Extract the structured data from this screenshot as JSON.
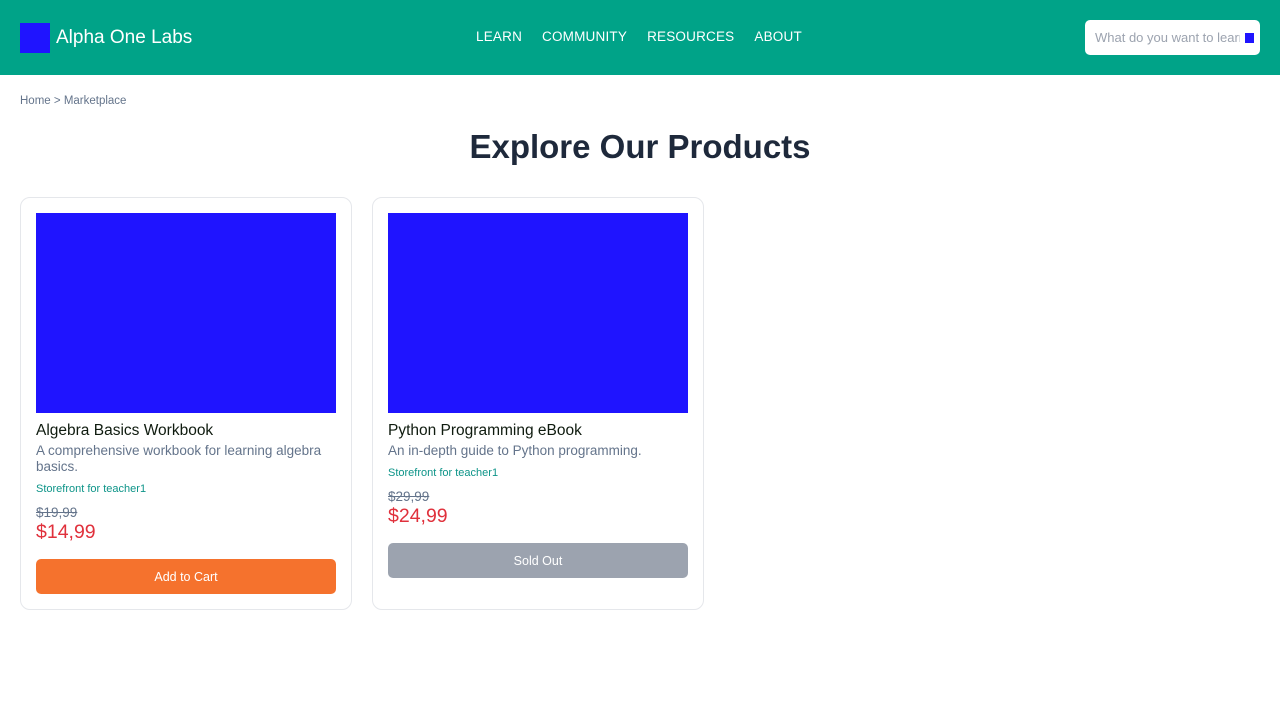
{
  "header": {
    "logo_text": "Alpha One Labs",
    "nav": [
      "LEARN",
      "COMMUNITY",
      "RESOURCES",
      "ABOUT"
    ],
    "search_placeholder": "What do you want to learn?"
  },
  "breadcrumb": {
    "home": "Home",
    "separator": ">",
    "current": "Marketplace"
  },
  "page_title": "Explore Our Products",
  "products": [
    {
      "title": "Algebra Basics Workbook",
      "description": "A comprehensive workbook for learning algebra basics.",
      "store": "Storefront for teacher1",
      "price_old": "$19,99",
      "price_new": "$14,99",
      "button_label": "Add to Cart"
    },
    {
      "title": "Python Programming eBook",
      "description": "An in-depth guide to Python programming.",
      "store": "Storefront for teacher1",
      "price_old": "$29,99",
      "price_new": "$24,99",
      "button_label": "Sold Out"
    }
  ],
  "colors": {
    "header_bg": "#00a388",
    "accent_blue": "#1f14ff",
    "cart_button": "#f5722d",
    "sold_out_button": "#9ca3af",
    "sale_price": "#e0313c",
    "store_link": "#0d9488"
  },
  "icons": {
    "logo": "logo-square-icon",
    "search": "search-icon"
  }
}
